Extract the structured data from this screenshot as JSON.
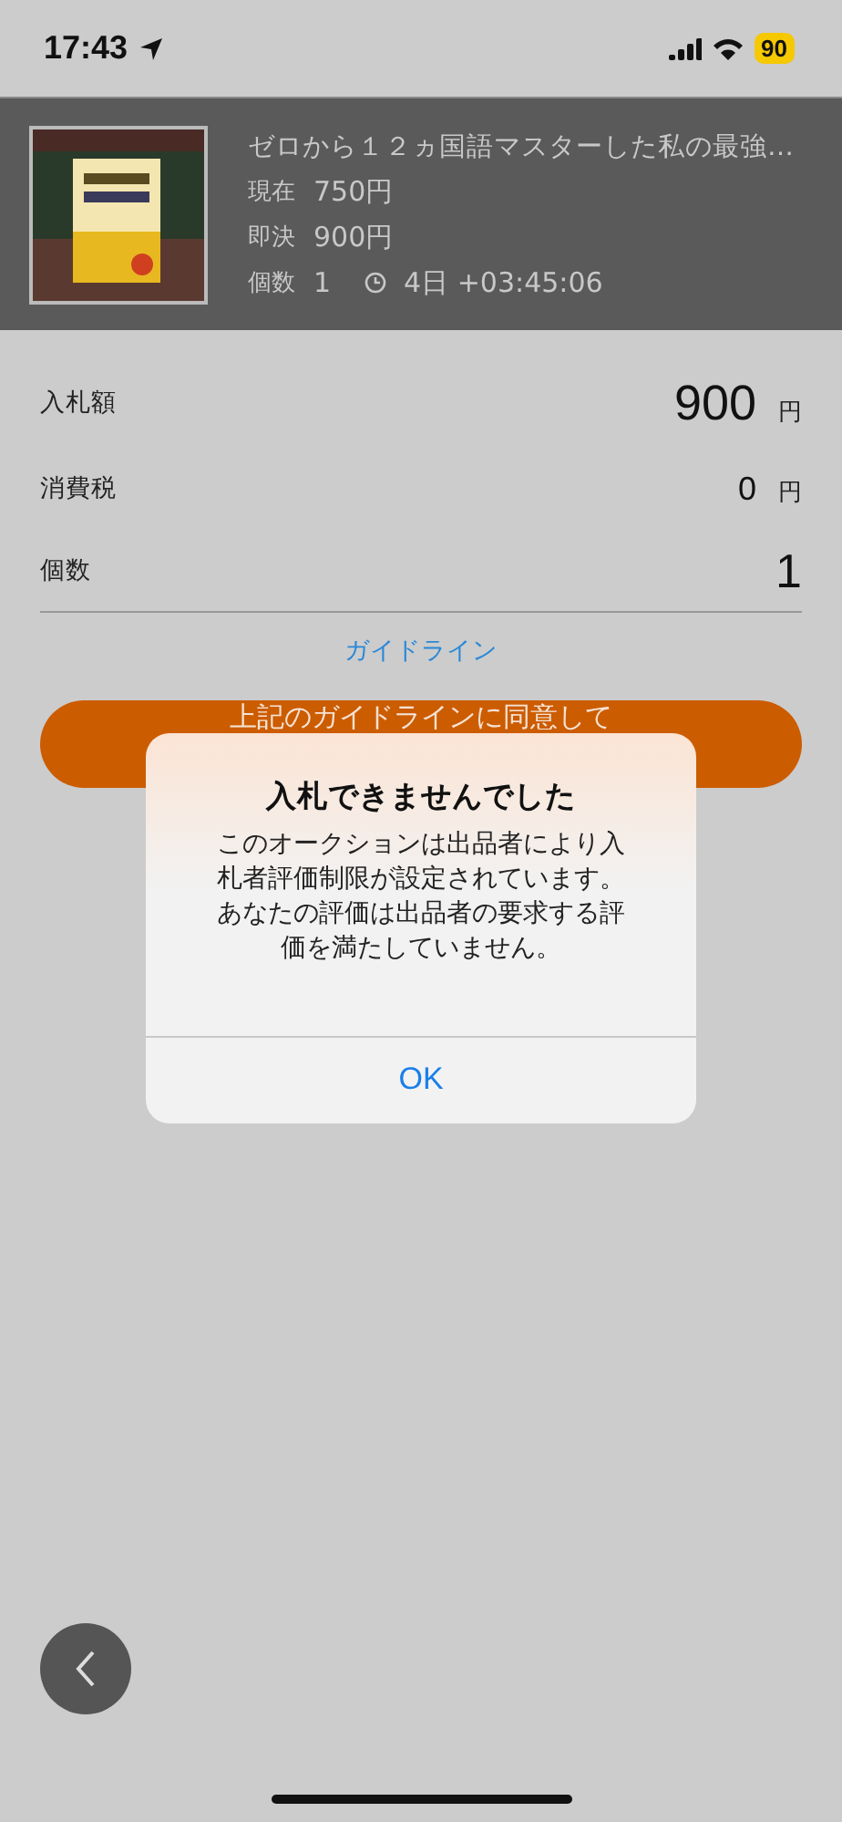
{
  "status_bar": {
    "time": "17:43",
    "battery": "90"
  },
  "item": {
    "title": "ゼロから１２ヵ国語マスターした私の最強…",
    "details": [
      {
        "label": "現在",
        "value": "750円"
      },
      {
        "label": "即決",
        "value": "900円"
      }
    ],
    "quantity": {
      "label": "個数",
      "value": "1",
      "time_left": "4日 +03:45:06"
    }
  },
  "form": {
    "rows": [
      {
        "label": "入札額",
        "value": "900",
        "unit": "円",
        "kind": "large"
      },
      {
        "label": "消費税",
        "value": "0",
        "unit": "円",
        "kind": "small"
      },
      {
        "label": "個数",
        "value": "1",
        "kind": "input"
      }
    ],
    "guideline_link": "ガイドライン",
    "submit_button": "上記のガイドラインに同意して"
  },
  "alert": {
    "title": "入札できませんでした",
    "message": "このオークションは出品者により入札者評価制限が設定されています。あなたの評価は出品者の要求する評価を満たしていません。",
    "button": "OK"
  }
}
